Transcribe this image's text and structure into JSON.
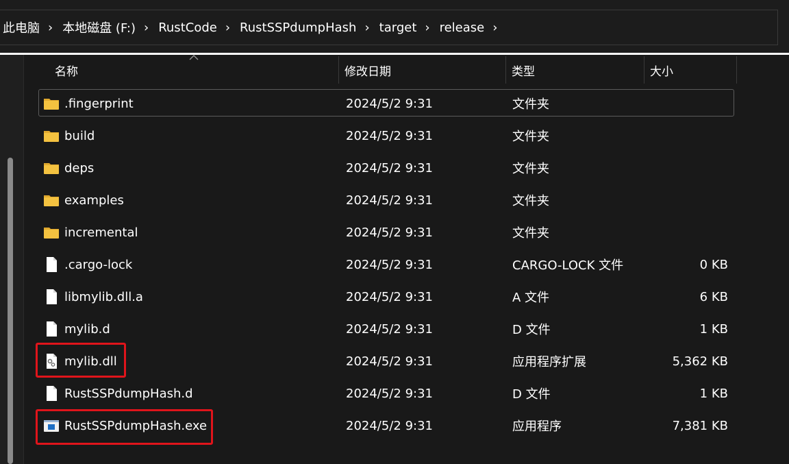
{
  "breadcrumb": [
    "此电脑",
    "本地磁盘 (F:)",
    "RustCode",
    "RustSSPdumpHash",
    "target",
    "release"
  ],
  "columns": {
    "name": "名称",
    "modified": "修改日期",
    "type": "类型",
    "size": "大小"
  },
  "files": [
    {
      "name": ".fingerprint",
      "modified": "2024/5/2 9:31",
      "type": "文件夹",
      "size": "",
      "icon": "folder-icon"
    },
    {
      "name": "build",
      "modified": "2024/5/2 9:31",
      "type": "文件夹",
      "size": "",
      "icon": "folder-icon"
    },
    {
      "name": "deps",
      "modified": "2024/5/2 9:31",
      "type": "文件夹",
      "size": "",
      "icon": "folder-icon"
    },
    {
      "name": "examples",
      "modified": "2024/5/2 9:31",
      "type": "文件夹",
      "size": "",
      "icon": "folder-icon"
    },
    {
      "name": "incremental",
      "modified": "2024/5/2 9:31",
      "type": "文件夹",
      "size": "",
      "icon": "folder-icon"
    },
    {
      "name": ".cargo-lock",
      "modified": "2024/5/2 9:31",
      "type": "CARGO-LOCK 文件",
      "size": "0 KB",
      "icon": "file-icon"
    },
    {
      "name": "libmylib.dll.a",
      "modified": "2024/5/2 9:31",
      "type": "A 文件",
      "size": "6 KB",
      "icon": "file-icon"
    },
    {
      "name": "mylib.d",
      "modified": "2024/5/2 9:31",
      "type": "D 文件",
      "size": "1 KB",
      "icon": "file-icon"
    },
    {
      "name": "mylib.dll",
      "modified": "2024/5/2 9:31",
      "type": "应用程序扩展",
      "size": "5,362 KB",
      "icon": "dll-file-icon"
    },
    {
      "name": "RustSSPdumpHash.d",
      "modified": "2024/5/2 9:31",
      "type": "D 文件",
      "size": "1 KB",
      "icon": "file-icon"
    },
    {
      "name": "RustSSPdumpHash.exe",
      "modified": "2024/5/2 9:31",
      "type": "应用程序",
      "size": "7,381 KB",
      "icon": "exe-file-icon"
    }
  ],
  "colors": {
    "background": "#191919",
    "highlight_box": "#e0141b",
    "folder": "#f4c240"
  }
}
